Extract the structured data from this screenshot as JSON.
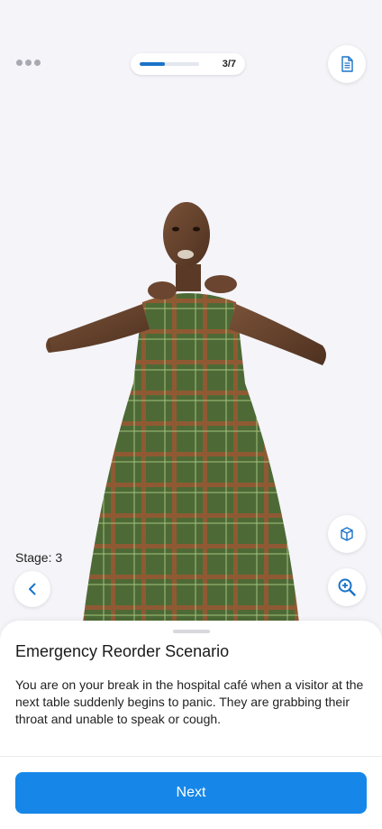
{
  "progress": {
    "text": "3/7",
    "fraction": 0.43
  },
  "stage": {
    "label": "Stage: 3"
  },
  "scenario": {
    "title": "Emergency Reorder Scenario",
    "description": "You are on your break in the hospital café when a visitor at the next table suddenly begins to panic. They are grabbing their throat and unable to speak or cough."
  },
  "actions": {
    "next_label": "Next"
  },
  "icons": {
    "menu": "more-dots-icon",
    "document": "document-icon",
    "cube": "cube-icon",
    "zoom": "zoom-in-icon",
    "back": "chevron-left-icon"
  },
  "colors": {
    "accent": "#1687e8",
    "progress": "#1a73c9"
  }
}
